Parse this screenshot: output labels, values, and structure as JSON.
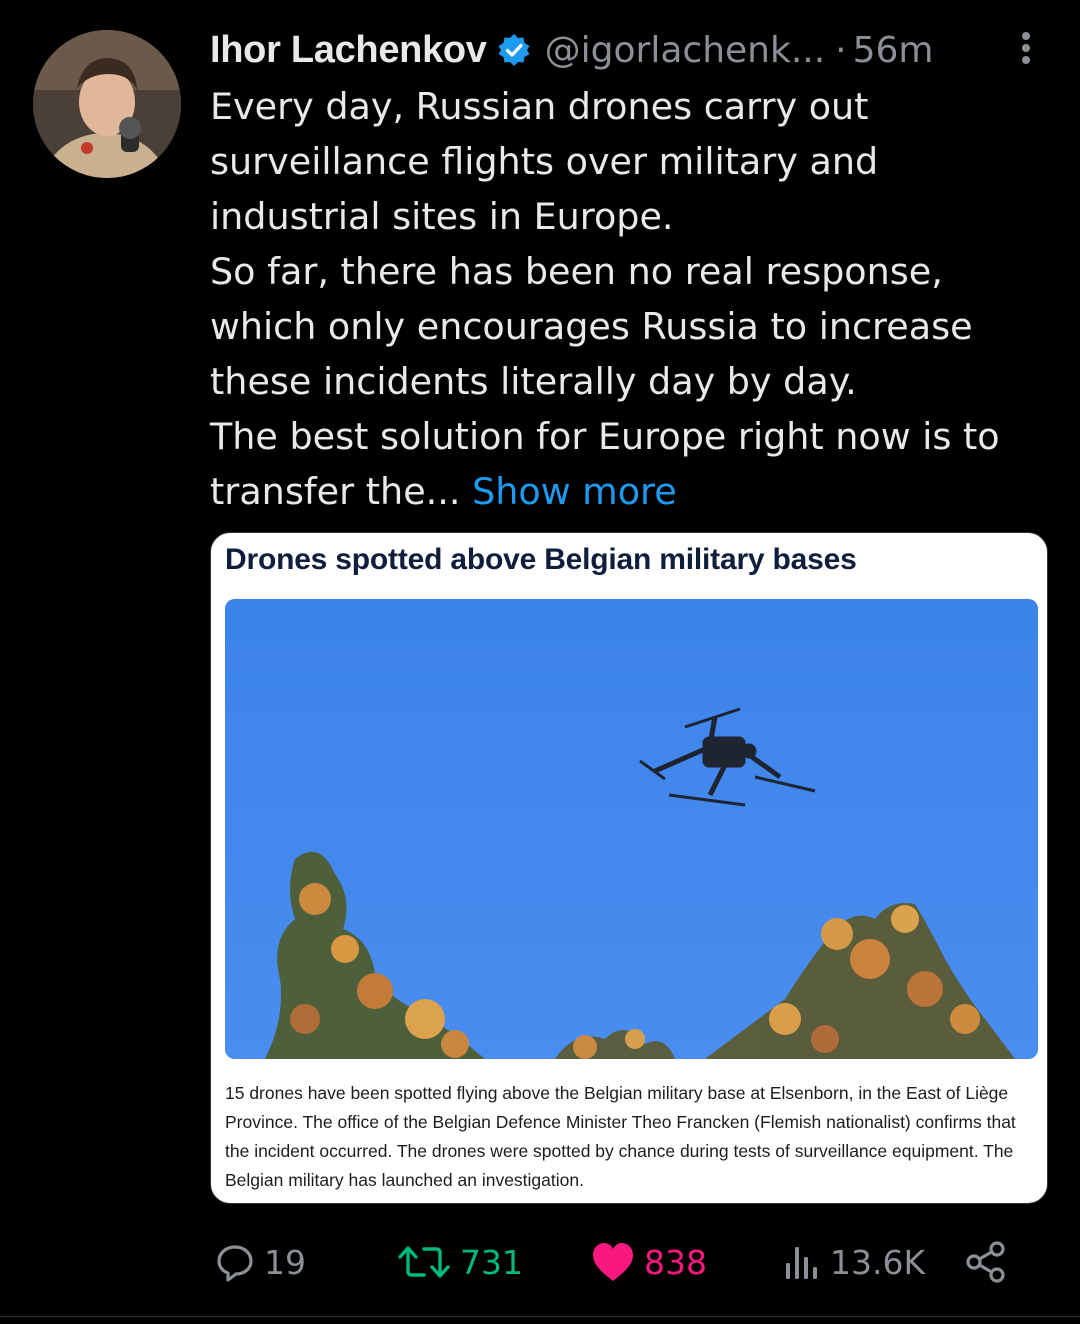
{
  "author": {
    "name": "Ihor Lachenkov",
    "handle": "@igorlachenk...",
    "separator": "·",
    "time": "56m",
    "avatar_icon": "profile-photo",
    "verified_icon": "verified-badge-icon",
    "verified_color": "#1d9bf0"
  },
  "tweet": {
    "lines": [
      "Every day, Russian drones carry out",
      "surveillance flights over military and",
      "industrial sites in Europe.",
      "So far, there has been no real response,",
      "which only encourages Russia to increase",
      "these incidents literally day by day.",
      "The best solution for Europe right now is to",
      "transfer the..."
    ],
    "show_more": "Show more"
  },
  "card": {
    "title": "Drones spotted above Belgian military bases",
    "image_icon": "drone-in-sky-photo",
    "caption": "15 drones have been spotted flying above the Belgian military base at Elsenborn, in the East of Liège Province. The office of the Belgian Defence Minister Theo Francken (Flemish nationalist) confirms that the incident occurred. The drones were spotted by chance during tests of surveillance equipment. The Belgian military has launched an investigation.",
    "expand_icon": "expand-icon"
  },
  "actions": {
    "reply": {
      "icon": "reply-icon",
      "count": "19"
    },
    "retweet": {
      "icon": "retweet-icon",
      "count": "731",
      "color": "#00ba7c"
    },
    "like": {
      "icon": "heart-icon",
      "count": "838",
      "color": "#f91880"
    },
    "views": {
      "icon": "views-icon",
      "count": "13.6K"
    },
    "share": {
      "icon": "share-icon"
    }
  },
  "colors": {
    "background": "#000000",
    "text": "#e7e9ea",
    "muted": "#8b9096",
    "link": "#1d9bf0"
  }
}
